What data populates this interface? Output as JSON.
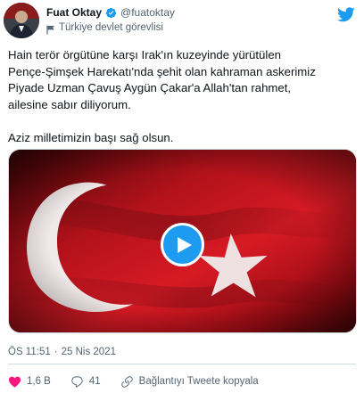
{
  "author": {
    "display_name": "Fuat Oktay",
    "handle": "@fuatoktay",
    "label": "Türkiye devlet görevlisi"
  },
  "tweet": {
    "lines": [
      "Hain terör örgütüne karşı Irak'ın kuzeyinde yürütülen",
      "Pençe-Şimşek Harekatı'nda şehit olan kahraman askerimiz",
      "Piyade Uzman Çavuş Aygün Çakar'a Allah'tan rahmet,",
      "ailesine sabır diliyorum."
    ],
    "closing": "Aziz milletimizin başı sağ olsun."
  },
  "timestamp": {
    "time": "ÖS 11:51",
    "separator": "·",
    "date": "25 Nis 2021"
  },
  "actions": {
    "likes": "1,6 B",
    "replies": "41",
    "copy_link": "Bağlantıyı Tweete kopyala"
  },
  "colors": {
    "accent": "#1d9bf0",
    "secondary_text": "#536471",
    "like_red": "#f91880",
    "flag_red": "#c8102e"
  },
  "icons": {
    "verified": "verified-badge-icon",
    "government_label": "turkey-flag-icon",
    "brand": "twitter-bird-icon",
    "play": "play-icon",
    "like": "heart-icon",
    "reply": "reply-bubble-icon",
    "link": "link-icon"
  }
}
